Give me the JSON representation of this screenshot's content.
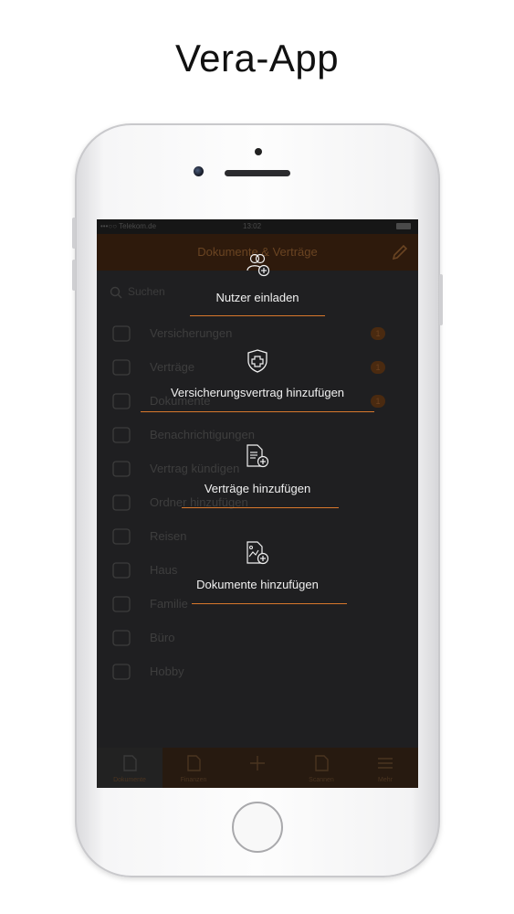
{
  "headline": "Vera-App",
  "colors": {
    "accent": "#d8782c",
    "overlay": "#1f1f21",
    "navbar": "#2e1a0c"
  },
  "statusbar": {
    "carrier": "•••○○ Telekom.de",
    "time": "13:02"
  },
  "navbar": {
    "title": "Dokumente & Verträge",
    "edit_icon": "pencil-icon"
  },
  "search": {
    "placeholder": "Suchen"
  },
  "menu": [
    {
      "label": "Versicherungen",
      "icon": "shield-icon",
      "badge": "1"
    },
    {
      "label": "Verträge",
      "icon": "contract-icon",
      "badge": "1"
    },
    {
      "label": "Dokumente",
      "icon": "document-icon",
      "badge": "1"
    },
    {
      "label": "Benachrichtigungen",
      "icon": "bell-icon",
      "badge": ""
    },
    {
      "label": "Vertrag kündigen",
      "icon": "cancel-contract-icon",
      "badge": ""
    },
    {
      "label": "Ordner hinzufügen",
      "icon": "folder-add-icon",
      "badge": ""
    },
    {
      "label": "Reisen",
      "icon": "travel-icon",
      "badge": ""
    },
    {
      "label": "Haus",
      "icon": "house-icon",
      "badge": ""
    },
    {
      "label": "Familie",
      "icon": "family-icon",
      "badge": ""
    },
    {
      "label": "Büro",
      "icon": "office-icon",
      "badge": ""
    },
    {
      "label": "Hobby",
      "icon": "hobby-icon",
      "badge": ""
    }
  ],
  "tabbar": [
    {
      "label": "Dokumente",
      "icon": "document-tab-icon"
    },
    {
      "label": "Finanzen",
      "icon": "finance-tab-icon"
    },
    {
      "label": "",
      "icon": "plus-icon"
    },
    {
      "label": "Scannen",
      "icon": "scan-tab-icon"
    },
    {
      "label": "Mehr",
      "icon": "menu-icon"
    }
  ],
  "actions": [
    {
      "label": "Nutzer einladen",
      "icon": "invite-user-icon"
    },
    {
      "label": "Versicherungsvertrag hinzufügen",
      "icon": "shield-plus-icon"
    },
    {
      "label": "Verträge hinzufügen",
      "icon": "contract-plus-icon"
    },
    {
      "label": "Dokumente hinzufügen",
      "icon": "document-plus-icon"
    }
  ]
}
